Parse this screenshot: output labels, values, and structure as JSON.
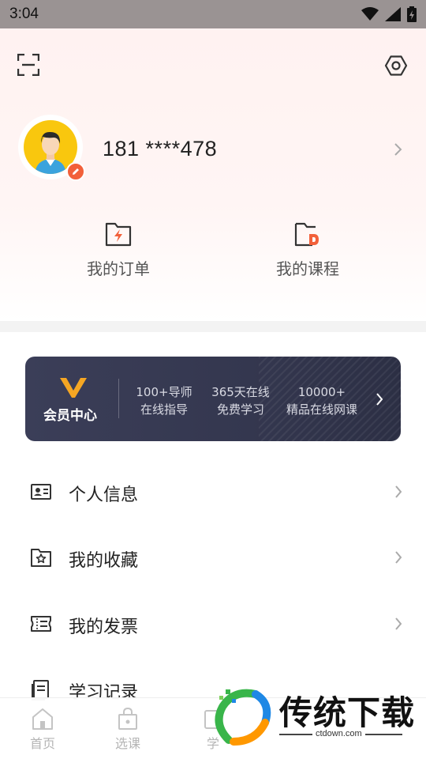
{
  "status_bar": {
    "time": "3:04"
  },
  "profile": {
    "phone": "181 ****478"
  },
  "quick_actions": [
    {
      "label": "我的订单",
      "icon": "order-folder-icon"
    },
    {
      "label": "我的课程",
      "icon": "course-folder-icon"
    }
  ],
  "vip": {
    "title": "会员中心",
    "features": [
      {
        "line1": "100+导师",
        "line2": "在线指导"
      },
      {
        "line1": "365天在线",
        "line2": "免费学习"
      },
      {
        "line1": "10000+",
        "line2": "精品在线网课"
      }
    ]
  },
  "menu": [
    {
      "label": "个人信息",
      "icon": "id-card-icon"
    },
    {
      "label": "我的收藏",
      "icon": "favorite-folder-icon"
    },
    {
      "label": "我的发票",
      "icon": "invoice-icon"
    },
    {
      "label": "学习记录",
      "icon": "study-record-icon"
    }
  ],
  "bottom_nav": [
    {
      "label": "首页",
      "icon": "home-icon"
    },
    {
      "label": "选课",
      "icon": "course-select-icon"
    },
    {
      "label": "学",
      "icon": "study-icon"
    }
  ],
  "watermark": {
    "title": "传统下载",
    "url": "ctdown.com"
  },
  "colors": {
    "accent": "#f2603a",
    "vip_bg": "#34374f",
    "vip_gold": "#f5a623",
    "avatar_bg": "#f9c70e"
  }
}
